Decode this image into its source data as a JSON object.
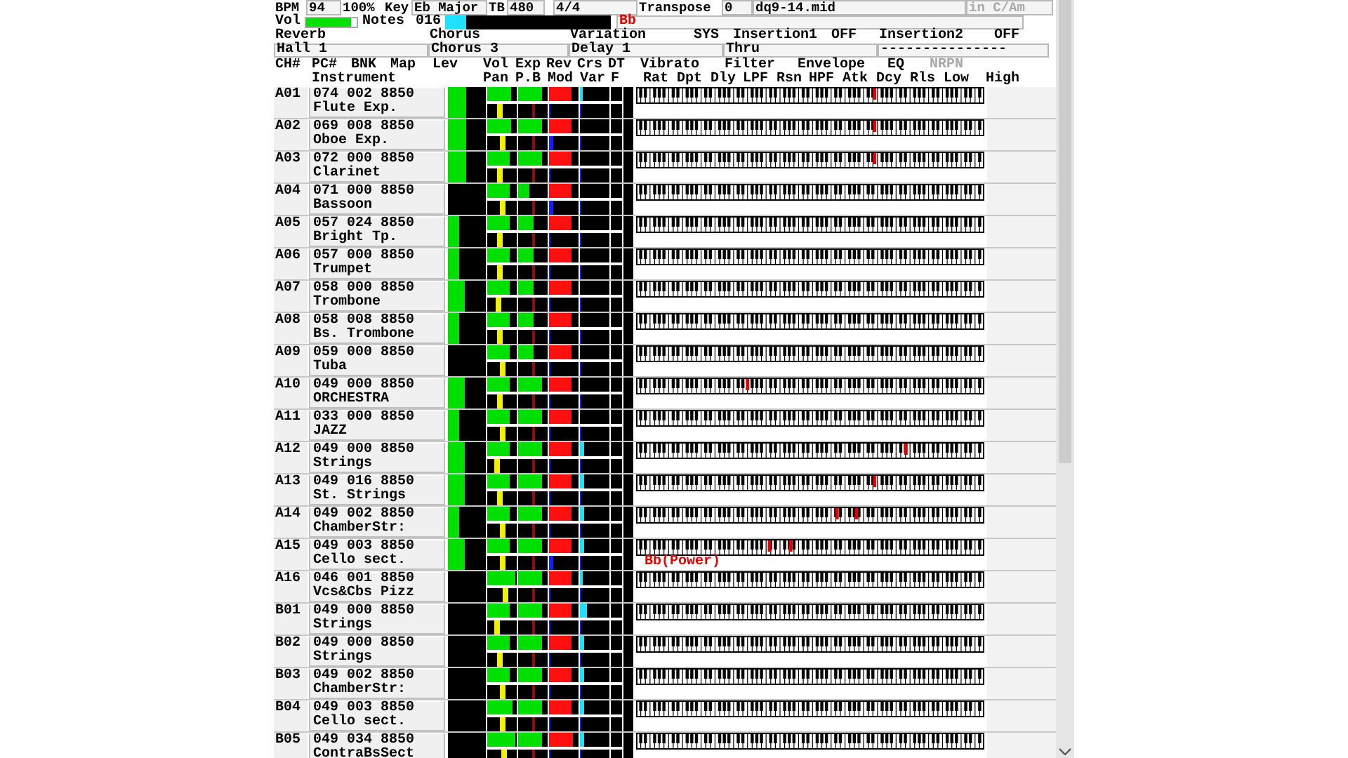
{
  "header": {
    "bpm_label": "BPM",
    "bpm": "94",
    "tempo_percent": "100%",
    "key_label": "Key",
    "key": "Eb Major",
    "tb_label": "TB",
    "timebase": "480",
    "time_signature": "4/4",
    "transpose_label": "Transpose",
    "transpose": "0",
    "file": "dq9-14.mid",
    "key_hint": "in C/Am",
    "vol_label": "Vol",
    "master_volume": {
      "level": 0.9
    },
    "notes_label": "Notes",
    "notes": "016",
    "notes_meter": {
      "level": 0.13
    },
    "chord": "Bb"
  },
  "effect_labels": [
    "Reverb",
    "Chorus",
    "Variation",
    "SYS",
    "Insertion1",
    "OFF",
    "Insertion2",
    "OFF"
  ],
  "effect_values": [
    "Hall 1",
    "Chorus 3",
    "Delay 1",
    "Thru",
    "---------------"
  ],
  "column_headers_top": [
    {
      "text": "CH#",
      "disabled": false
    },
    {
      "text": "PC#",
      "disabled": false
    },
    {
      "text": "BNK",
      "disabled": false
    },
    {
      "text": "Map",
      "disabled": false
    },
    {
      "text": "Lev",
      "disabled": false
    },
    {
      "text": "Vol",
      "disabled": false
    },
    {
      "text": "Exp",
      "disabled": false
    },
    {
      "text": "Rev",
      "disabled": false
    },
    {
      "text": "Crs",
      "disabled": false
    },
    {
      "text": "DT",
      "disabled": false
    },
    {
      "text": "Vibrato",
      "disabled": false
    },
    {
      "text": "Filter",
      "disabled": false
    },
    {
      "text": "Envelope",
      "disabled": false
    },
    {
      "text": "EQ",
      "disabled": false
    },
    {
      "text": "NRPN",
      "disabled": true
    }
  ],
  "column_headers_bottom": [
    "Instrument",
    "Pan",
    "P.B",
    "Mod",
    "Var",
    "F",
    "Rat",
    "Dpt",
    "Dly",
    "LPF",
    "Rsn",
    "HPF",
    "Atk",
    "Dcy",
    "Rls",
    "Low",
    "High"
  ],
  "channels": [
    {
      "ch": "A01",
      "program": "074 002 8850",
      "instrument": "Flute Exp.",
      "lev": {
        "level": 0.48
      },
      "vol": {
        "level": 0.8
      },
      "exp": {
        "level": 0.8
      },
      "rev": {
        "level": 0.75
      },
      "crs": {
        "level": 0.08
      },
      "pan": {
        "level": 0.45
      },
      "pb": {
        "level": 0.5
      },
      "mod": {
        "level": 0.05
      },
      "var": {
        "level": 0.05
      },
      "held_keys": [
        {
          "level": 0.685
        }
      ]
    },
    {
      "ch": "A02",
      "program": "069 008 8850",
      "instrument": "Oboe Exp.",
      "lev": {
        "level": 0.48
      },
      "vol": {
        "level": 0.8
      },
      "exp": {
        "level": 0.8
      },
      "rev": {
        "level": 0.75
      },
      "crs": {
        "level": 0
      },
      "pan": {
        "level": 0.5
      },
      "pb": {
        "level": 0.5
      },
      "mod": {
        "level": 0.15
      },
      "var": {
        "level": 0.05
      },
      "held_keys": [
        {
          "level": 0.685
        }
      ]
    },
    {
      "ch": "A03",
      "program": "072 000 8850",
      "instrument": "Clarinet",
      "lev": {
        "level": 0.48
      },
      "vol": {
        "level": 0.75
      },
      "exp": {
        "level": 0.8
      },
      "rev": {
        "level": 0.75
      },
      "crs": {
        "level": 0
      },
      "pan": {
        "level": 0.45
      },
      "pb": {
        "level": 0.5
      },
      "mod": {
        "level": 0.05
      },
      "var": {
        "level": 0.05
      },
      "held_keys": [
        {
          "level": 0.685
        }
      ]
    },
    {
      "ch": "A04",
      "program": "071 000 8850",
      "instrument": "Bassoon",
      "lev": {
        "level": 0
      },
      "vol": {
        "level": 0.75
      },
      "exp": {
        "level": 0.4
      },
      "rev": {
        "level": 0.75
      },
      "crs": {
        "level": 0
      },
      "pan": {
        "level": 0.5
      },
      "pb": {
        "level": 0.5
      },
      "mod": {
        "level": 0.15
      },
      "var": {
        "level": 0.05
      }
    },
    {
      "ch": "A05",
      "program": "057 024 8850",
      "instrument": "Bright Tp.",
      "lev": {
        "level": 0.3
      },
      "vol": {
        "level": 0.75
      },
      "exp": {
        "level": 0.5
      },
      "rev": {
        "level": 0.75
      },
      "crs": {
        "level": 0
      },
      "pan": {
        "level": 0.45
      },
      "pb": {
        "level": 0.5
      },
      "mod": {
        "level": 0.05
      },
      "var": {
        "level": 0.05
      }
    },
    {
      "ch": "A06",
      "program": "057 000 8850",
      "instrument": "Trumpet",
      "lev": {
        "level": 0.3
      },
      "vol": {
        "level": 0.75
      },
      "exp": {
        "level": 0.5
      },
      "rev": {
        "level": 0.75
      },
      "crs": {
        "level": 0
      },
      "pan": {
        "level": 0.45
      },
      "pb": {
        "level": 0.5
      },
      "mod": {
        "level": 0.05
      },
      "var": {
        "level": 0.05
      }
    },
    {
      "ch": "A07",
      "program": "058 000 8850",
      "instrument": "Trombone",
      "lev": {
        "level": 0.45
      },
      "vol": {
        "level": 0.75
      },
      "exp": {
        "level": 0.5
      },
      "rev": {
        "level": 0.75
      },
      "crs": {
        "level": 0
      },
      "pan": {
        "level": 0.4
      },
      "pb": {
        "level": 0.5
      },
      "mod": {
        "level": 0.05
      },
      "var": {
        "level": 0.05
      }
    },
    {
      "ch": "A08",
      "program": "058 008 8850",
      "instrument": "Bs. Trombone",
      "lev": {
        "level": 0.3
      },
      "vol": {
        "level": 0.75
      },
      "exp": {
        "level": 0.5
      },
      "rev": {
        "level": 0.75
      },
      "crs": {
        "level": 0
      },
      "pan": {
        "level": 0.45
      },
      "pb": {
        "level": 0.5
      },
      "mod": {
        "level": 0.05
      },
      "var": {
        "level": 0.05
      }
    },
    {
      "ch": "A09",
      "program": "059 000 8850",
      "instrument": "Tuba",
      "lev": {
        "level": 0
      },
      "vol": {
        "level": 0.75
      },
      "exp": {
        "level": 0.5
      },
      "rev": {
        "level": 0.75
      },
      "crs": {
        "level": 0
      },
      "pan": {
        "level": 0.5
      },
      "pb": {
        "level": 0.5
      },
      "mod": {
        "level": 0.05
      },
      "var": {
        "level": 0.05
      }
    },
    {
      "ch": "A10",
      "program": "049 000 8850",
      "instrument": "ORCHESTRA",
      "lev": {
        "level": 0.45
      },
      "vol": {
        "level": 0.75
      },
      "exp": {
        "level": 0.8
      },
      "rev": {
        "level": 0.75
      },
      "crs": {
        "level": 0
      },
      "pan": {
        "level": 0.45
      },
      "pb": {
        "level": 0.5
      },
      "mod": {
        "level": 0.05
      },
      "var": {
        "level": 0.05
      },
      "held_keys": [
        {
          "level": 0.32
        }
      ]
    },
    {
      "ch": "A11",
      "program": "033 000 8850",
      "instrument": "JAZZ",
      "lev": {
        "level": 0.3
      },
      "vol": {
        "level": 0.75
      },
      "exp": {
        "level": 0.8
      },
      "rev": {
        "level": 0.75
      },
      "crs": {
        "level": 0
      },
      "pan": {
        "level": 0.5
      },
      "pb": {
        "level": 0.5
      },
      "mod": {
        "level": 0.05
      },
      "var": {
        "level": 0.05
      }
    },
    {
      "ch": "A12",
      "program": "049 000 8850",
      "instrument": "Strings",
      "lev": {
        "level": 0.45
      },
      "vol": {
        "level": 0.75
      },
      "exp": {
        "level": 0.8
      },
      "rev": {
        "level": 0.75
      },
      "crs": {
        "level": 0.15
      },
      "pan": {
        "level": 0.35
      },
      "pb": {
        "level": 0.5
      },
      "mod": {
        "level": 0.05
      },
      "var": {
        "level": 0.05
      },
      "held_keys": [
        {
          "level": 0.775
        }
      ]
    },
    {
      "ch": "A13",
      "program": "049 016 8850",
      "instrument": "St. Strings",
      "lev": {
        "level": 0.45
      },
      "vol": {
        "level": 0.75
      },
      "exp": {
        "level": 0.8
      },
      "rev": {
        "level": 0.75
      },
      "crs": {
        "level": 0.12
      },
      "pan": {
        "level": 0.45
      },
      "pb": {
        "level": 0.5
      },
      "mod": {
        "level": 0.05
      },
      "var": {
        "level": 0.05
      },
      "held_keys": [
        {
          "level": 0.685
        }
      ]
    },
    {
      "ch": "A14",
      "program": "049 002 8850",
      "instrument": "ChamberStr:",
      "lev": {
        "level": 0.3
      },
      "vol": {
        "level": 0.75
      },
      "exp": {
        "level": 0.8
      },
      "rev": {
        "level": 0.75
      },
      "crs": {
        "level": 0.12
      },
      "pan": {
        "level": 0.5
      },
      "pb": {
        "level": 0.5
      },
      "mod": {
        "level": 0.05
      },
      "var": {
        "level": 0.05
      },
      "held_keys": [
        {
          "level": 0.577
        },
        {
          "level": 0.633
        }
      ]
    },
    {
      "ch": "A15",
      "program": "049 003 8850",
      "instrument": "Cello sect.",
      "lev": {
        "level": 0.45
      },
      "vol": {
        "level": 0.75
      },
      "exp": {
        "level": 0.8
      },
      "rev": {
        "level": 0.75
      },
      "crs": {
        "level": 0.12
      },
      "pan": {
        "level": 0.5
      },
      "pb": {
        "level": 0.5
      },
      "mod": {
        "level": 0.12
      },
      "var": {
        "level": 0.05
      },
      "held_keys": [
        {
          "level": 0.383
        },
        {
          "level": 0.444
        }
      ],
      "chord": "Bb(Power)"
    },
    {
      "ch": "A16",
      "program": "046 001 8850",
      "instrument": "Vcs&Cbs Pizz",
      "lev": {
        "level": 0
      },
      "vol": {
        "level": 0.95
      },
      "exp": {
        "level": 0.8
      },
      "rev": {
        "level": 0.75
      },
      "crs": {
        "level": 0.1
      },
      "pan": {
        "level": 0.6
      },
      "pb": {
        "level": 0.5
      },
      "mod": {
        "level": 0.05
      },
      "var": {
        "level": 0.05
      }
    },
    {
      "ch": "B01",
      "program": "049 000 8850",
      "instrument": "Strings",
      "lev": {
        "level": 0
      },
      "vol": {
        "level": 0.75
      },
      "exp": {
        "level": 0.8
      },
      "rev": {
        "level": 0.75
      },
      "crs": {
        "level": 0.25
      },
      "pan": {
        "level": 0.35
      },
      "pb": {
        "level": 0.5
      },
      "mod": {
        "level": 0.05
      },
      "var": {
        "level": 0.05
      }
    },
    {
      "ch": "B02",
      "program": "049 000 8850",
      "instrument": "Strings",
      "lev": {
        "level": 0
      },
      "vol": {
        "level": 0.75
      },
      "exp": {
        "level": 0.8
      },
      "rev": {
        "level": 0.75
      },
      "crs": {
        "level": 0.12
      },
      "pan": {
        "level": 0.45
      },
      "pb": {
        "level": 0.5
      },
      "mod": {
        "level": 0.05
      },
      "var": {
        "level": 0.05
      }
    },
    {
      "ch": "B03",
      "program": "049 002 8850",
      "instrument": "ChamberStr:",
      "lev": {
        "level": 0
      },
      "vol": {
        "level": 0.75
      },
      "exp": {
        "level": 0.8
      },
      "rev": {
        "level": 0.75
      },
      "crs": {
        "level": 0.12
      },
      "pan": {
        "level": 0.5
      },
      "pb": {
        "level": 0.5
      },
      "mod": {
        "level": 0.05
      },
      "var": {
        "level": 0.05
      }
    },
    {
      "ch": "B04",
      "program": "049 003 8850",
      "instrument": "Cello sect.",
      "lev": {
        "level": 0
      },
      "vol": {
        "level": 0.85
      },
      "exp": {
        "level": 0.8
      },
      "rev": {
        "level": 0.75
      },
      "crs": {
        "level": 0.12
      },
      "pan": {
        "level": 0.5
      },
      "pb": {
        "level": 0.5
      },
      "mod": {
        "level": 0.05
      },
      "var": {
        "level": 0.05
      }
    },
    {
      "ch": "B05",
      "program": "049 034 8850",
      "instrument": "ContraBsSect",
      "lev": {
        "level": 0
      },
      "vol": {
        "level": 0.95
      },
      "exp": {
        "level": 0.8
      },
      "rev": {
        "level": 0.8
      },
      "crs": {
        "level": 0.12
      },
      "pan": {
        "level": 0.55
      },
      "pb": {
        "level": 0.5
      },
      "mod": {
        "level": 0.05
      },
      "var": {
        "level": 0.05
      }
    }
  ]
}
